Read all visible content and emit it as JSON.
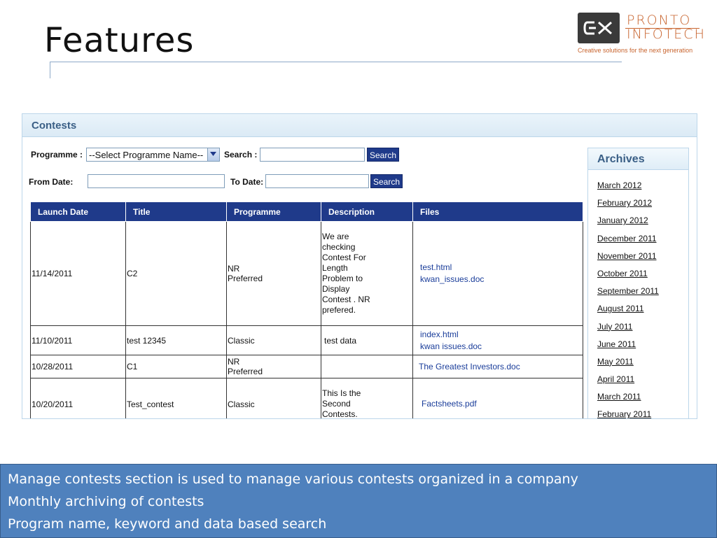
{
  "slide": {
    "title": "Features",
    "logo": {
      "line1": "PRONTO",
      "line2": "INFOTECH",
      "tagline": "Creative solutions for the next generation",
      "icon": "pronto-logo-mark-icon"
    }
  },
  "contests": {
    "header": "Contests",
    "programme_label": "Programme :",
    "programme_selected": "--Select Programme Name--",
    "search_label": "Search :",
    "search_value": "",
    "search_button": "Search",
    "from_date_label": "From Date:",
    "from_date_value": "",
    "to_date_label": "To Date:",
    "to_date_value": "",
    "date_search_button": "Search",
    "columns": [
      "Launch Date",
      "Title",
      "Programme",
      "Description",
      "Files"
    ],
    "rows": [
      {
        "launch_date": "11/14/2011",
        "title": "C2",
        "programme": "NR Preferred",
        "description": "We are checking Contest For Length Problem to Display Contest . NR prefered.",
        "files": [
          "test.html",
          "kwan_issues.doc"
        ]
      },
      {
        "launch_date": "11/10/2011",
        "title": "test 12345",
        "programme": "Classic",
        "description": "test data",
        "files": [
          "index.html",
          "kwan issues.doc"
        ]
      },
      {
        "launch_date": "10/28/2011",
        "title": "C1",
        "programme": "NR Preferred",
        "description": "",
        "files": [
          "The Greatest Investors.doc"
        ]
      },
      {
        "launch_date": "10/20/2011",
        "title": "Test_contest",
        "programme": "Classic",
        "description": "This Is the Second Contests.",
        "files": [
          "Factsheets.pdf"
        ]
      }
    ]
  },
  "archives": {
    "header": "Archives",
    "items": [
      "March 2012",
      "February 2012",
      "January 2012",
      "December 2011",
      "November 2011",
      "October 2011",
      "September 2011",
      "August 2011",
      "July 2011",
      "June 2011",
      "May 2011",
      "April 2011",
      "March 2011",
      "February 2011"
    ]
  },
  "notes": [
    "Manage contests section is used to manage various contests organized in a company",
    "Monthly archiving of contests",
    "Program name, keyword and data based search"
  ],
  "colors": {
    "table_header": "#1f3a8a",
    "notes_background": "#4f81bd",
    "logo_accent": "#c8642e",
    "panel_title": "#3a5f86"
  }
}
